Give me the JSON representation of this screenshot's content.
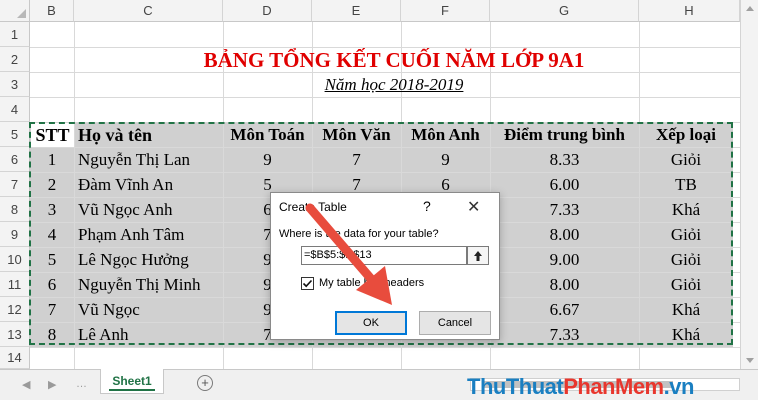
{
  "columns": [
    "B",
    "C",
    "D",
    "E",
    "F",
    "G",
    "H"
  ],
  "rows": [
    "1",
    "2",
    "3",
    "4",
    "5",
    "6",
    "7",
    "8",
    "9",
    "10",
    "11",
    "12",
    "13",
    "14"
  ],
  "title": "BẢNG TỔNG KẾT CUỐI NĂM LỚP 9A1",
  "subtitle": "Năm học 2018-2019",
  "headers": [
    "STT",
    "Họ và tên",
    "Môn Toán",
    "Môn Văn",
    "Môn Anh",
    "Điểm trung bình",
    "Xếp loại"
  ],
  "data_rows": [
    [
      "1",
      "Nguyễn Thị Lan",
      "9",
      "7",
      "9",
      "8.33",
      "Giỏi"
    ],
    [
      "2",
      "Đàm Vĩnh An",
      "5",
      "7",
      "6",
      "6.00",
      "TB"
    ],
    [
      "3",
      "Vũ Ngọc Anh",
      "6",
      "",
      "",
      "7.33",
      "Khá"
    ],
    [
      "4",
      "Phạm Anh Tâm",
      "7",
      "",
      "",
      "8.00",
      "Giỏi"
    ],
    [
      "5",
      "Lê Ngọc Hưởng",
      "9",
      "",
      "",
      "9.00",
      "Giỏi"
    ],
    [
      "6",
      "Nguyễn Thị Minh",
      "9",
      "",
      "",
      "8.00",
      "Giỏi"
    ],
    [
      "7",
      "Vũ Ngọc",
      "9",
      "",
      "",
      "6.67",
      "Khá"
    ],
    [
      "8",
      "Lê Anh",
      "7",
      "",
      "",
      "7.33",
      "Khá"
    ]
  ],
  "dialog": {
    "title": "Create Table",
    "help": "?",
    "close": "✕",
    "prompt": "Where is the data for your table?",
    "range": "=$B$5:$H$13",
    "checkbox_label": "My table has headers",
    "ok": "OK",
    "cancel": "Cancel"
  },
  "sheet_tab": "Sheet1",
  "add_sheet": "+",
  "watermark": {
    "part1": "ThuThuat",
    "part2": "PhanMem",
    "part3": ".vn",
    "color1": "#1a7fc1",
    "color2": "#e8362d",
    "color3": "#1a7fc1"
  },
  "colors": {
    "accent": "#217346",
    "title_red": "#e00000",
    "table_fill": "#d0d0d0",
    "arrow": "#e84c3d"
  }
}
